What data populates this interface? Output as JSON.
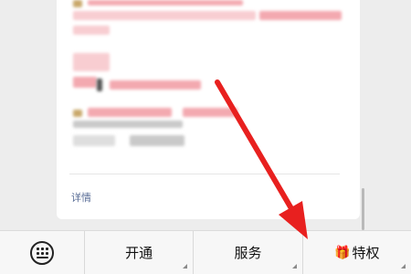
{
  "card": {
    "detail_link": "详情"
  },
  "menu": {
    "keyboard_icon": "keyboard-icon",
    "items": [
      {
        "label": "开通",
        "has_submenu": true
      },
      {
        "label": "服务",
        "has_submenu": true
      },
      {
        "label": "特权",
        "icon": "gift-icon",
        "icon_glyph": "🎁",
        "has_submenu": true
      }
    ]
  },
  "annotation": {
    "arrow_color": "#e8201f"
  }
}
